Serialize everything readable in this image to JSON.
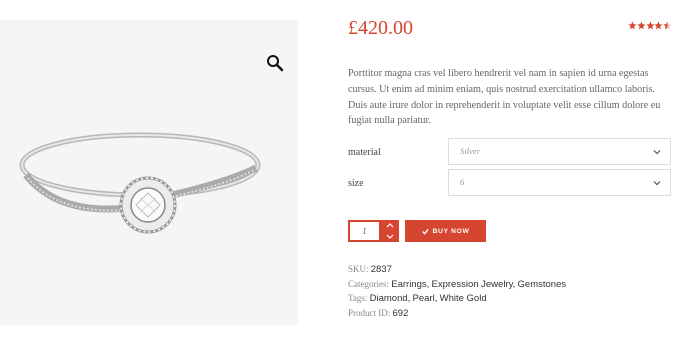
{
  "product": {
    "price": "£420.00",
    "rating": 4.5,
    "description": "Porttitor magna cras vel  libero hendrerit vel nam in sapien id urna egestas cursus. Ut enim ad minim eniam, quis nostrud exercitation ullamco laboris. Duis aute irure dolor in reprehenderit in voluptate velit esse cillum dolore eu fugiat nulla pariatur.",
    "image_icon": "zoom-icon"
  },
  "options": {
    "material": {
      "label": "material",
      "value": "Silver"
    },
    "size": {
      "label": "size",
      "value": "6"
    }
  },
  "cart": {
    "quantity": "1",
    "buy_label": "BUY NOW"
  },
  "meta": {
    "sku_label": "SKU:",
    "sku": "2837",
    "categories_label": "Categories:",
    "categories": [
      "Earrings",
      "Expression Jewelry",
      "Gemstones"
    ],
    "tags_label": "Tags:",
    "tags": [
      "Diamond",
      "Pearl",
      "White Gold"
    ],
    "product_id_label": "Product ID:",
    "product_id": "692"
  },
  "colors": {
    "accent": "#d6452f"
  }
}
